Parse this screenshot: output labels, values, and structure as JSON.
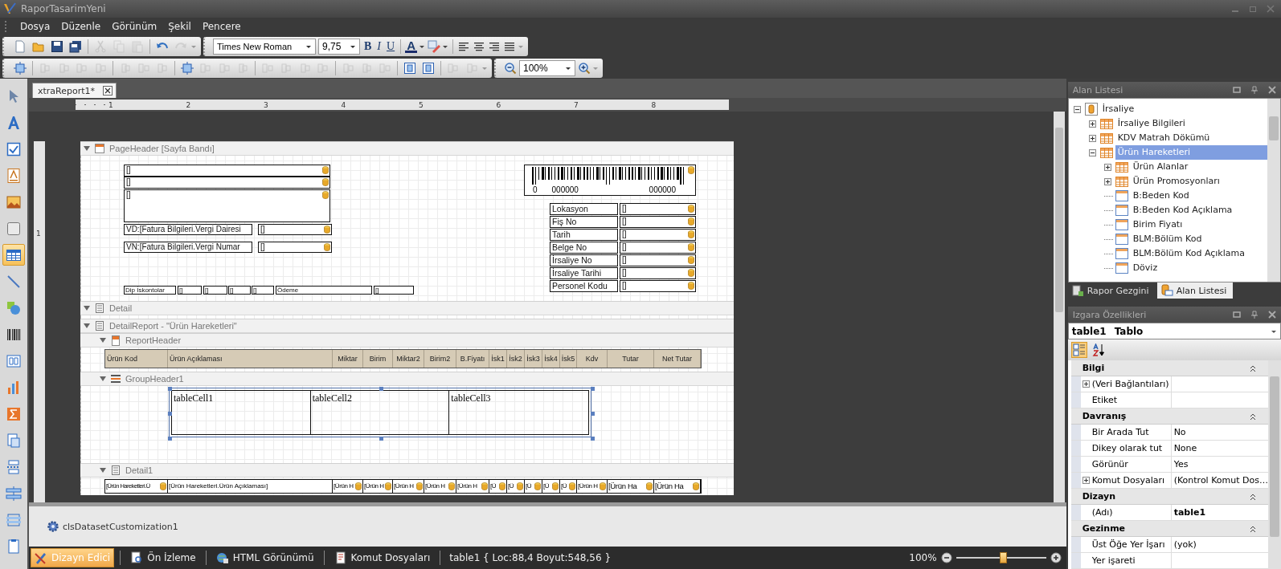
{
  "window": {
    "title": "RaporTasarimYeni"
  },
  "menu": [
    "Dosya",
    "Düzenle",
    "Görünüm",
    "Şekil",
    "Pencere"
  ],
  "toolbar": {
    "standard": [
      {
        "disabled": false
      },
      {
        "disabled": false
      },
      {
        "disabled": false
      },
      {
        "disabled": false
      },
      {
        "disabled": true
      },
      {
        "disabled": true
      },
      {
        "disabled": true
      },
      {
        "disabled": false
      },
      {
        "disabled": true
      }
    ],
    "font_name": "Times New Roman",
    "font_size": "9,75",
    "format_buttons": [
      "B",
      "I",
      "U"
    ],
    "font_color": "A",
    "layout": [
      {
        "disabled": false
      },
      {
        "disabled": true
      },
      {
        "disabled": true
      },
      {
        "disabled": true
      },
      {
        "disabled": true
      },
      {
        "disabled": true
      },
      {
        "disabled": true
      },
      {
        "disabled": true
      },
      {
        "disabled": false
      },
      {
        "disabled": true
      },
      {
        "disabled": true
      },
      {
        "disabled": true
      },
      {
        "disabled": true
      },
      {
        "disabled": true
      },
      {
        "disabled": true
      },
      {
        "disabled": true
      },
      {
        "disabled": true
      },
      {
        "disabled": true
      },
      {
        "disabled": true
      },
      {
        "disabled": false
      },
      {
        "disabled": false
      },
      {
        "disabled": true
      },
      {
        "disabled": true
      }
    ],
    "zoom": "100%"
  },
  "toolbox": [
    {
      "kind": "pointer",
      "selected": false
    },
    {
      "kind": "label",
      "selected": false
    },
    {
      "kind": "checkbox",
      "selected": false
    },
    {
      "kind": "richtext",
      "selected": false
    },
    {
      "kind": "picture",
      "selected": false
    },
    {
      "kind": "panel",
      "selected": false
    },
    {
      "kind": "table",
      "selected": true
    },
    {
      "kind": "line",
      "selected": false
    },
    {
      "kind": "shape",
      "selected": false
    },
    {
      "kind": "barcode",
      "selected": false
    },
    {
      "kind": "zipcode",
      "selected": false
    },
    {
      "kind": "chart",
      "selected": false
    },
    {
      "kind": "sum",
      "selected": false
    },
    {
      "kind": "subreport",
      "selected": false
    },
    {
      "kind": "pagebreak",
      "selected": false
    },
    {
      "kind": "crossline",
      "selected": false
    },
    {
      "kind": "crossbox",
      "selected": false
    },
    {
      "kind": "pageinfo",
      "selected": false
    }
  ],
  "document_tab": {
    "label": "xtraReport1*"
  },
  "ruler": {
    "labels": [
      "1",
      "2",
      "3",
      "4",
      "5",
      "6",
      "7",
      "8"
    ],
    "vertical_labels": [
      "1"
    ]
  },
  "bands": [
    {
      "kind": "page_header",
      "title": "PageHeader [Sayfa Bandı]",
      "expanded": true,
      "text_fields": [
        "[]",
        "[]",
        "[]"
      ],
      "tax_fields": [
        {
          "label": "VD:[Fatura Bilgileri.Vergi Dairesi",
          "value": "[]"
        },
        {
          "label": "VN:[Fatura Bilgileri.Vergi Numar",
          "value": "[]"
        }
      ],
      "barcode": {
        "start": "0",
        "left_digits": "000000",
        "right_digits": "000000"
      },
      "info_rows": [
        {
          "label": "Lokasyon",
          "value": "[]"
        },
        {
          "label": "Fiş No",
          "value": "[]"
        },
        {
          "label": "Tarih",
          "value": "[]"
        },
        {
          "label": "Belge No",
          "value": "[]"
        },
        {
          "label": "İrsaliye No",
          "value": "[]"
        },
        {
          "label": "İrsaliye Tarihi",
          "value": "[]"
        },
        {
          "label": "Personel Kodu",
          "value": "[]"
        }
      ],
      "footer_row": [
        "Dip İskontolar",
        "[]",
        "[]",
        "[]",
        "[]",
        "Ödeme",
        "[]"
      ]
    },
    {
      "kind": "detail",
      "title": "Detail",
      "expanded": true
    },
    {
      "kind": "detail_report",
      "title": "DetailReport - \"Ürün Hareketleri\"",
      "expanded": true,
      "children": [
        {
          "kind": "report_header",
          "title": "ReportHeader",
          "expanded": true,
          "columns": [
            "Ürün Kod",
            "Ürün Açıklaması",
            "Miktar",
            "Birim",
            "Miktar2",
            "Birim2",
            "B.Fiyatı",
            "İsk1",
            "İsk2",
            "İsk3",
            "İsk4",
            "İsk5",
            "Kdv",
            "Tutar",
            "Net Tutar"
          ]
        },
        {
          "kind": "group_header",
          "title": "GroupHeader1",
          "expanded": true,
          "cells": [
            "tableCell1",
            "tableCell2",
            "tableCell3"
          ],
          "selected": true
        },
        {
          "kind": "detail_row",
          "title": "Detail1",
          "expanded": true,
          "cells": [
            "[Ürün Hareketleri.Ü",
            "[Ürün Hareketleri.Ürün Açıklaması]",
            "[Ürün H",
            "[Ürün H",
            "[Ürün H",
            "[Ürün H",
            "[Ürün H",
            "[Ü",
            "[Ü",
            "[Ü",
            "[Ü",
            "[Ü",
            "[Ürün H",
            "[Ürün Ha",
            "[Ürün Ha"
          ]
        }
      ]
    }
  ],
  "component_tray": [
    "clsDatasetCustomization1"
  ],
  "field_list": {
    "title": "Alan Listesi",
    "tree": [
      {
        "label": "İrsaliye",
        "kind": "source",
        "expanded": true,
        "selected": false,
        "children": [
          {
            "label": "İrsaliye Bilgileri",
            "kind": "table",
            "expanded": false,
            "selected": false
          },
          {
            "label": "KDV Matrah Dökümü",
            "kind": "table",
            "expanded": false,
            "selected": false
          },
          {
            "label": "Ürün Hareketleri",
            "kind": "table",
            "expanded": true,
            "selected": true,
            "children": [
              {
                "label": "Ürün Alanlar",
                "kind": "table",
                "expanded": false,
                "selected": false
              },
              {
                "label": "Ürün Promosyonları",
                "kind": "table",
                "expanded": false,
                "selected": false
              },
              {
                "label": "B:Beden Kod",
                "kind": "text",
                "selected": false
              },
              {
                "label": "B:Beden Kod Açıklama",
                "kind": "text",
                "selected": false
              },
              {
                "label": "Birim Fiyatı",
                "kind": "number",
                "selected": false
              },
              {
                "label": "BLM:Bölüm Kod",
                "kind": "text",
                "selected": false
              },
              {
                "label": "BLM:Bölüm Kod Açıklama",
                "kind": "text",
                "selected": false
              },
              {
                "label": "Döviz",
                "kind": "text",
                "selected": false
              }
            ]
          }
        ]
      }
    ],
    "tabs": [
      {
        "label": "Rapor Gezgini",
        "selected": false
      },
      {
        "label": "Alan Listesi",
        "selected": true
      }
    ]
  },
  "properties": {
    "title": "Izgara Özellikleri",
    "object_name": "table1",
    "object_type": "Tablo",
    "categories": [
      {
        "name": "Bilgi",
        "expanded": true,
        "rows": [
          {
            "name": "(Veri Bağlantıları)",
            "expandable": true
          },
          {
            "name": "Etiket",
            "expandable": false
          }
        ]
      },
      {
        "name": "Davranış",
        "expanded": true,
        "rows": [
          {
            "name": "Bir Arada Tut",
            "value": "No",
            "expandable": false,
            "bold": false
          },
          {
            "name": "Dikey olarak tut",
            "value": "None",
            "expandable": false,
            "bold": false
          },
          {
            "name": "Görünür",
            "value": "Yes",
            "expandable": false,
            "bold": false
          },
          {
            "name": "Komut Dosyaları",
            "value": "(Kontrol Komut Dos…",
            "expandable": true,
            "bold": false
          }
        ]
      },
      {
        "name": "Dizayn",
        "expanded": true,
        "rows": [
          {
            "name": "(Adı)",
            "value": "table1",
            "expandable": false,
            "bold": true
          }
        ]
      },
      {
        "name": "Gezinme",
        "expanded": true,
        "rows": [
          {
            "name": "Üst Öğe Yer İşarı",
            "value": "(yok)",
            "expandable": false,
            "bold": false
          },
          {
            "name": "Yer işareti",
            "expandable": false
          }
        ]
      }
    ]
  },
  "status_bar": {
    "views": [
      {
        "label": "Dizayn Edici",
        "selected": true
      },
      {
        "label": "Ön İzleme",
        "selected": false
      },
      {
        "label": "HTML Görünümü",
        "selected": false
      },
      {
        "label": "Komut Dosyaları",
        "selected": false
      }
    ],
    "info": "table1 { Loc:88,4 Boyut:548,56 }",
    "zoom": {
      "label": "100%",
      "level": 0.52
    }
  }
}
